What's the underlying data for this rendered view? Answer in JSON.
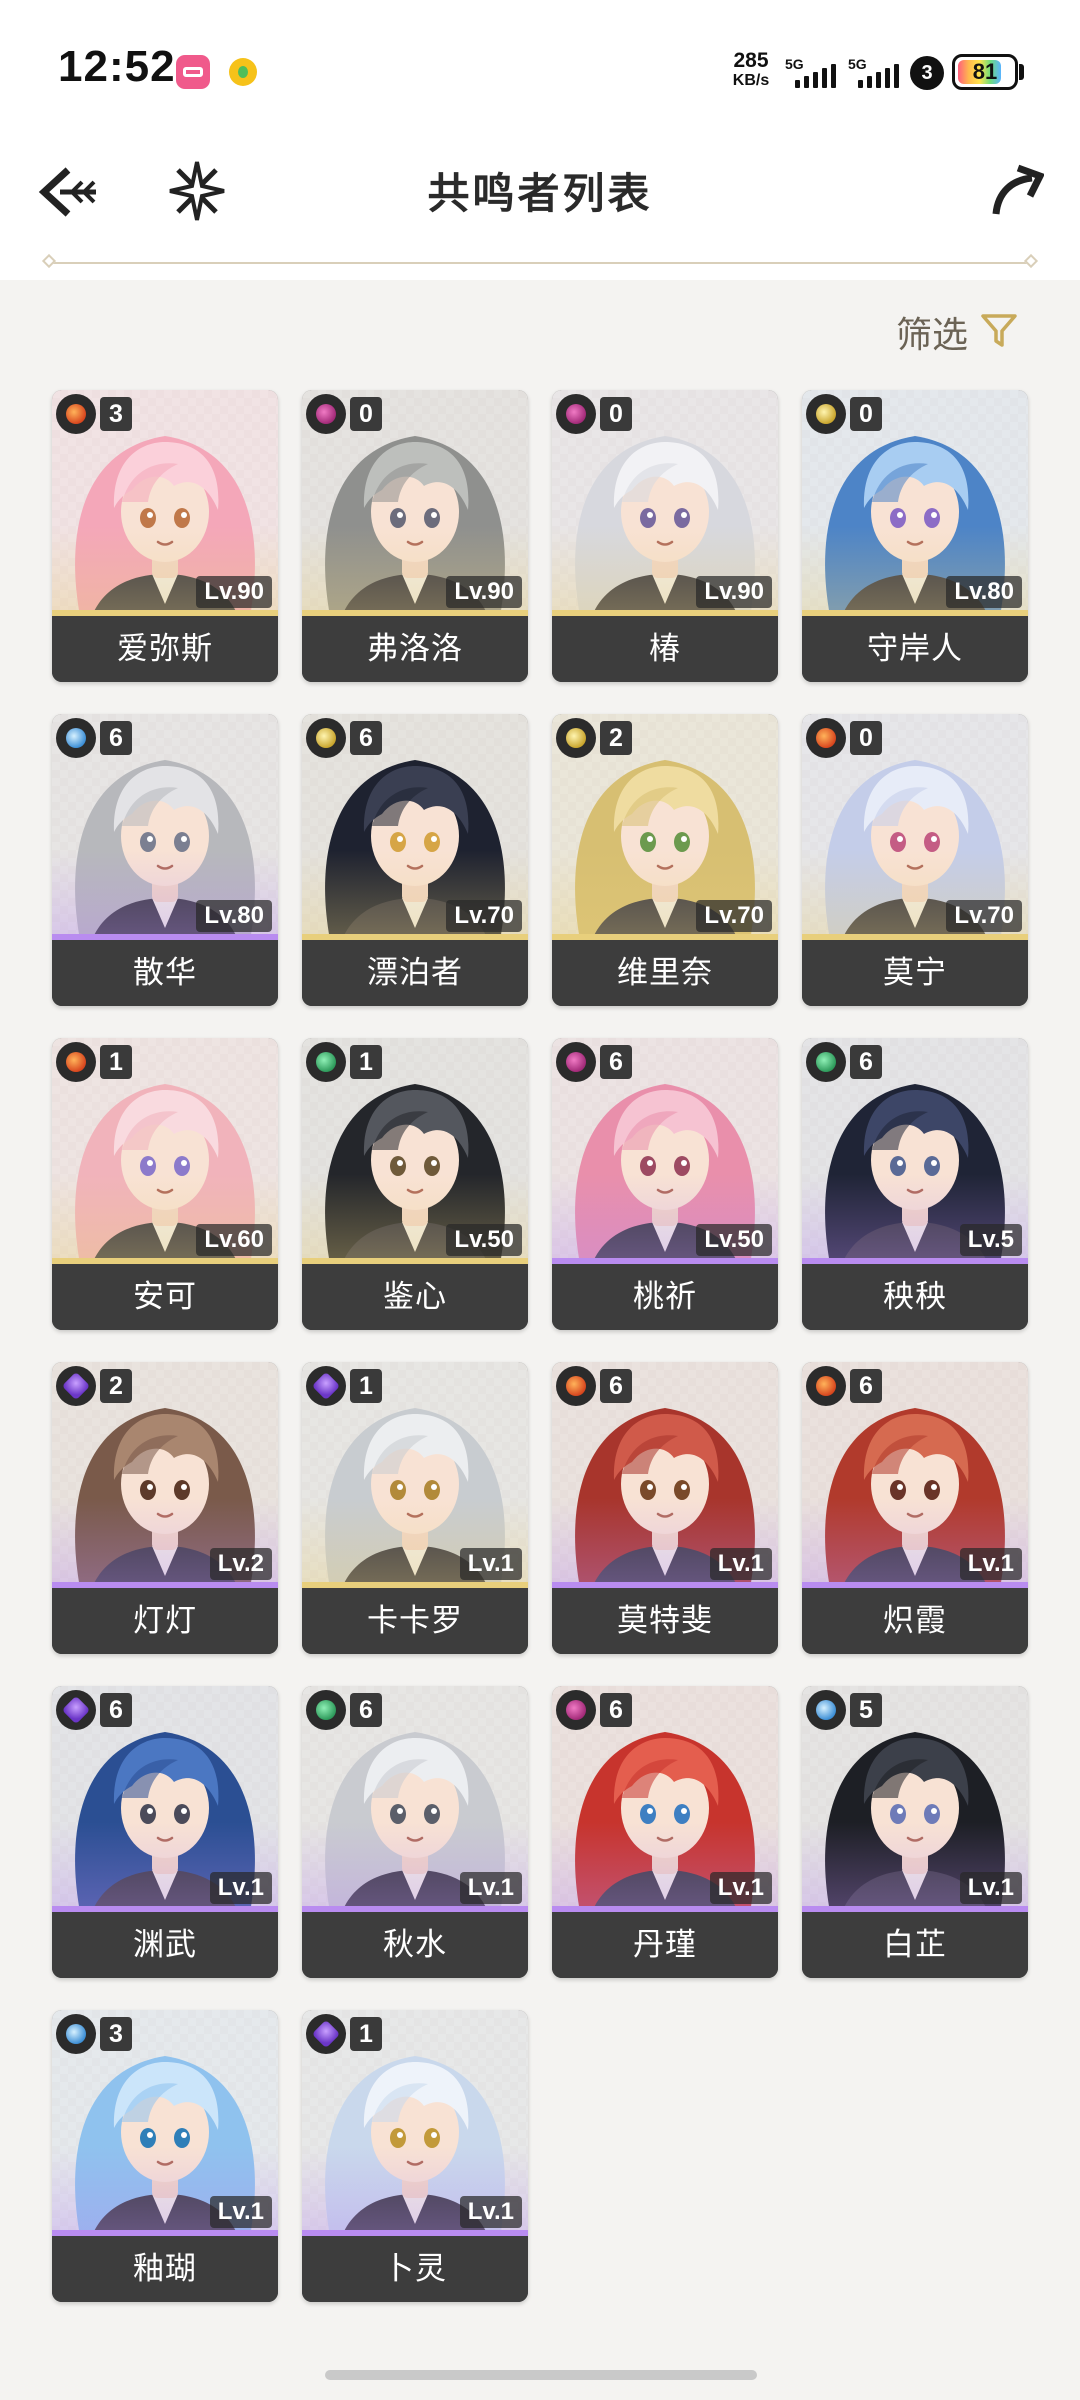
{
  "status_bar": {
    "time": "12:52",
    "net_speed": "285",
    "net_speed_unit": "KB/s",
    "signal_1": "5G",
    "signal_2": "5G",
    "battery": "81",
    "app_icons": [
      "bilibili-icon",
      "music-app-icon"
    ],
    "eco_icon": "3"
  },
  "header": {
    "title": "共鸣者列表",
    "back_icon": "back-arrow-icon",
    "spark_icon": "spark-icon",
    "share_icon": "share-icon"
  },
  "filter": {
    "label": "筛选",
    "icon": "filter-icon"
  },
  "colors": {
    "background": "#f4f3f1",
    "card_bar": "#3d3d3d",
    "five_star": "#e8cf7c",
    "four_star": "#b98cf0",
    "accent_gold": "#c8aa5a"
  },
  "characters": [
    {
      "name": "爱弥斯",
      "level": "Lv.90",
      "sequence": "3",
      "element": "fusion",
      "rarity": 5,
      "hair": "#f4a7b9",
      "hair2": "#fbd0da",
      "eyes": "#c0784a",
      "bg": "#fbe3ea"
    },
    {
      "name": "弗洛洛",
      "level": "Lv.90",
      "sequence": "0",
      "element": "havoc",
      "rarity": 5,
      "hair": "#8f908e",
      "hair2": "#bdbfbc",
      "eyes": "#6c6c7c",
      "bg": "#e6e4e2"
    },
    {
      "name": "椿",
      "level": "Lv.90",
      "sequence": "0",
      "element": "havoc",
      "rarity": 5,
      "hair": "#d7d8de",
      "hair2": "#f2f2f5",
      "eyes": "#7a6aa0",
      "bg": "#eceaee"
    },
    {
      "name": "守岸人",
      "level": "Lv.80",
      "sequence": "0",
      "element": "spectro",
      "rarity": 5,
      "hair": "#4d84c7",
      "hair2": "#a8cdf2",
      "eyes": "#8c6cc6",
      "bg": "#e3ecf7"
    },
    {
      "name": "散华",
      "level": "Lv.80",
      "sequence": "6",
      "element": "glacio",
      "rarity": 4,
      "hair": "#b7b8bc",
      "hair2": "#e3e3e6",
      "eyes": "#7b7f91",
      "bg": "#e9e8ea"
    },
    {
      "name": "漂泊者",
      "level": "Lv.70",
      "sequence": "6",
      "element": "spectro",
      "rarity": 5,
      "hair": "#1e2230",
      "hair2": "#3a3f52",
      "eyes": "#d6a546",
      "bg": "#e6e3de"
    },
    {
      "name": "维里奈",
      "level": "Lv.70",
      "sequence": "2",
      "element": "spectro",
      "rarity": 5,
      "hair": "#d7bf72",
      "hair2": "#efdca0",
      "eyes": "#6c9a4e",
      "bg": "#efe9d6"
    },
    {
      "name": "莫宁",
      "level": "Lv.70",
      "sequence": "0",
      "element": "fusion",
      "rarity": 5,
      "hair": "#c4cde9",
      "hair2": "#e7ecf8",
      "eyes": "#c45c84",
      "bg": "#e8eaf2"
    },
    {
      "name": "安可",
      "level": "Lv.60",
      "sequence": "1",
      "element": "fusion",
      "rarity": 5,
      "hair": "#f1b3bb",
      "hair2": "#f9dadf",
      "eyes": "#8c7acb",
      "bg": "#f6e5e6"
    },
    {
      "name": "鉴心",
      "level": "Lv.50",
      "sequence": "1",
      "element": "aero",
      "rarity": 5,
      "hair": "#24262b",
      "hair2": "#54575e",
      "eyes": "#6f5a3a",
      "bg": "#e4e3e1"
    },
    {
      "name": "桃祈",
      "level": "Lv.50",
      "sequence": "6",
      "element": "havoc",
      "rarity": 4,
      "hair": "#e98fab",
      "hair2": "#f6c3d2",
      "eyes": "#9d4a62",
      "bg": "#f3e3e8"
    },
    {
      "name": "秧秧",
      "level": "Lv.5",
      "sequence": "6",
      "element": "aero",
      "rarity": 4,
      "hair": "#1f2436",
      "hair2": "#3d4667",
      "eyes": "#5a6a96",
      "bg": "#e3e5ec"
    },
    {
      "name": "灯灯",
      "level": "Lv.2",
      "sequence": "2",
      "element": "electro",
      "rarity": 4,
      "hair": "#7a5a4a",
      "hair2": "#a9866f",
      "eyes": "#5d3a2a",
      "bg": "#ece4de"
    },
    {
      "name": "卡卡罗",
      "level": "Lv.1",
      "sequence": "1",
      "element": "electro",
      "rarity": 5,
      "hair": "#c8ccd0",
      "hair2": "#eceef0",
      "eyes": "#b28a3a",
      "bg": "#e9e9e8"
    },
    {
      "name": "莫特斐",
      "level": "Lv.1",
      "sequence": "6",
      "element": "fusion",
      "rarity": 4,
      "hair": "#a8352c",
      "hair2": "#d05a4a",
      "eyes": "#7a4a2a",
      "bg": "#efe1de"
    },
    {
      "name": "炽霞",
      "level": "Lv.1",
      "sequence": "6",
      "element": "fusion",
      "rarity": 4,
      "hair": "#b13a2c",
      "hair2": "#d66a50",
      "eyes": "#6a3428",
      "bg": "#efe0dc"
    },
    {
      "name": "渊武",
      "level": "Lv.1",
      "sequence": "6",
      "element": "electro",
      "rarity": 4,
      "hair": "#2b4f93",
      "hair2": "#4b77c2",
      "eyes": "#4b4b5a",
      "bg": "#e1e5ee"
    },
    {
      "name": "秋水",
      "level": "Lv.1",
      "sequence": "6",
      "element": "aero",
      "rarity": 4,
      "hair": "#c9cbd0",
      "hair2": "#eceef1",
      "eyes": "#5b5f6a",
      "bg": "#e9e9ea"
    },
    {
      "name": "丹瑾",
      "level": "Lv.1",
      "sequence": "6",
      "element": "havoc",
      "rarity": 4,
      "hair": "#c7342d",
      "hair2": "#e45e4e",
      "eyes": "#3e7fc2",
      "bg": "#f1e0de"
    },
    {
      "name": "白芷",
      "level": "Lv.1",
      "sequence": "5",
      "element": "glacio",
      "rarity": 4,
      "hair": "#1d1f25",
      "hair2": "#3c404a",
      "eyes": "#6e7bb8",
      "bg": "#e6e6e8"
    },
    {
      "name": "釉瑚",
      "level": "Lv.1",
      "sequence": "3",
      "element": "glacio",
      "rarity": 4,
      "hair": "#8fc2ee",
      "hair2": "#cbe5fa",
      "eyes": "#2f7fb8",
      "bg": "#e5eef7"
    },
    {
      "name": "卜灵",
      "level": "Lv.1",
      "sequence": "1",
      "element": "electro",
      "rarity": 4,
      "hair": "#c9d8ec",
      "hair2": "#eef3fa",
      "eyes": "#c29a3a",
      "bg": "#e9ecf1"
    }
  ]
}
